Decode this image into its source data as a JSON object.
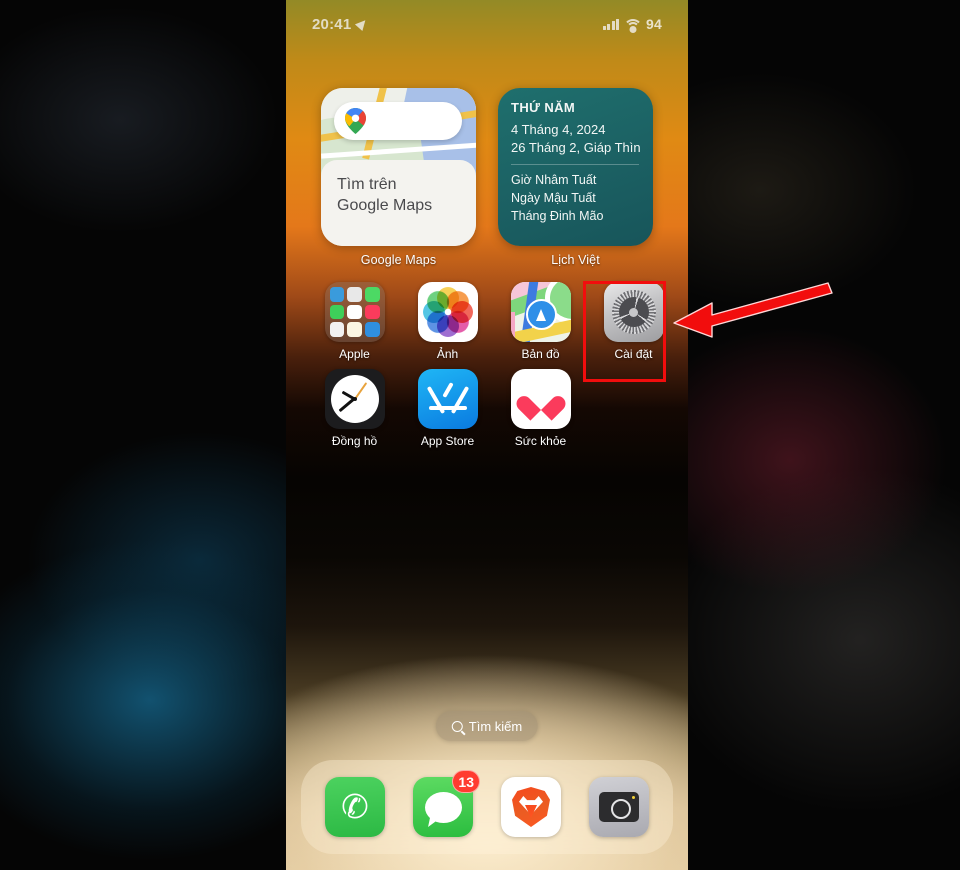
{
  "status_bar": {
    "time": "20:41",
    "location_icon": "location-arrow-icon",
    "signal_icon": "cellular-signal-icon",
    "wifi_icon": "wifi-icon",
    "battery_percent": "94"
  },
  "widgets": [
    {
      "name": "google-maps",
      "label": "Google Maps",
      "search_placeholder": "",
      "card_line1": "Tìm trên",
      "card_line2": "Google Maps",
      "icon": "google-maps-pin-icon"
    },
    {
      "name": "lich-viet",
      "label": "Lịch Việt",
      "weekday": "THỨ NĂM",
      "solar_date": "4 Tháng 4, 2024",
      "lunar_date": "26 Tháng 2, Giáp Thìn",
      "hour": "Giờ Nhâm Tuất",
      "day": "Ngày Mậu Tuất",
      "month": "Tháng Đinh Mão",
      "accent": "#1f6f6d"
    }
  ],
  "app_rows": [
    [
      {
        "label": "Apple",
        "icon": "folder-icon"
      },
      {
        "label": "Ảnh",
        "icon": "photos-icon"
      },
      {
        "label": "Bản đồ",
        "icon": "apple-maps-icon"
      },
      {
        "label": "Cài đặt",
        "icon": "settings-gear-icon",
        "highlighted": true
      }
    ],
    [
      {
        "label": "Đồng hồ",
        "icon": "clock-icon"
      },
      {
        "label": "App Store",
        "icon": "app-store-icon"
      },
      {
        "label": "Sức khỏe",
        "icon": "health-heart-icon"
      }
    ]
  ],
  "search": {
    "label": "Tìm kiếm",
    "icon": "search-icon"
  },
  "dock": [
    {
      "label": "Phone",
      "icon": "phone-icon",
      "badge": ""
    },
    {
      "label": "Messages",
      "icon": "messages-icon",
      "badge": "13"
    },
    {
      "label": "Brave",
      "icon": "brave-lion-icon",
      "badge": ""
    },
    {
      "label": "Camera",
      "icon": "camera-icon",
      "badge": ""
    }
  ],
  "annotations": {
    "highlight_color": "#f20d0d",
    "highlight_target": "Cài đặt",
    "arrow": "red-arrow-pointing-left"
  }
}
